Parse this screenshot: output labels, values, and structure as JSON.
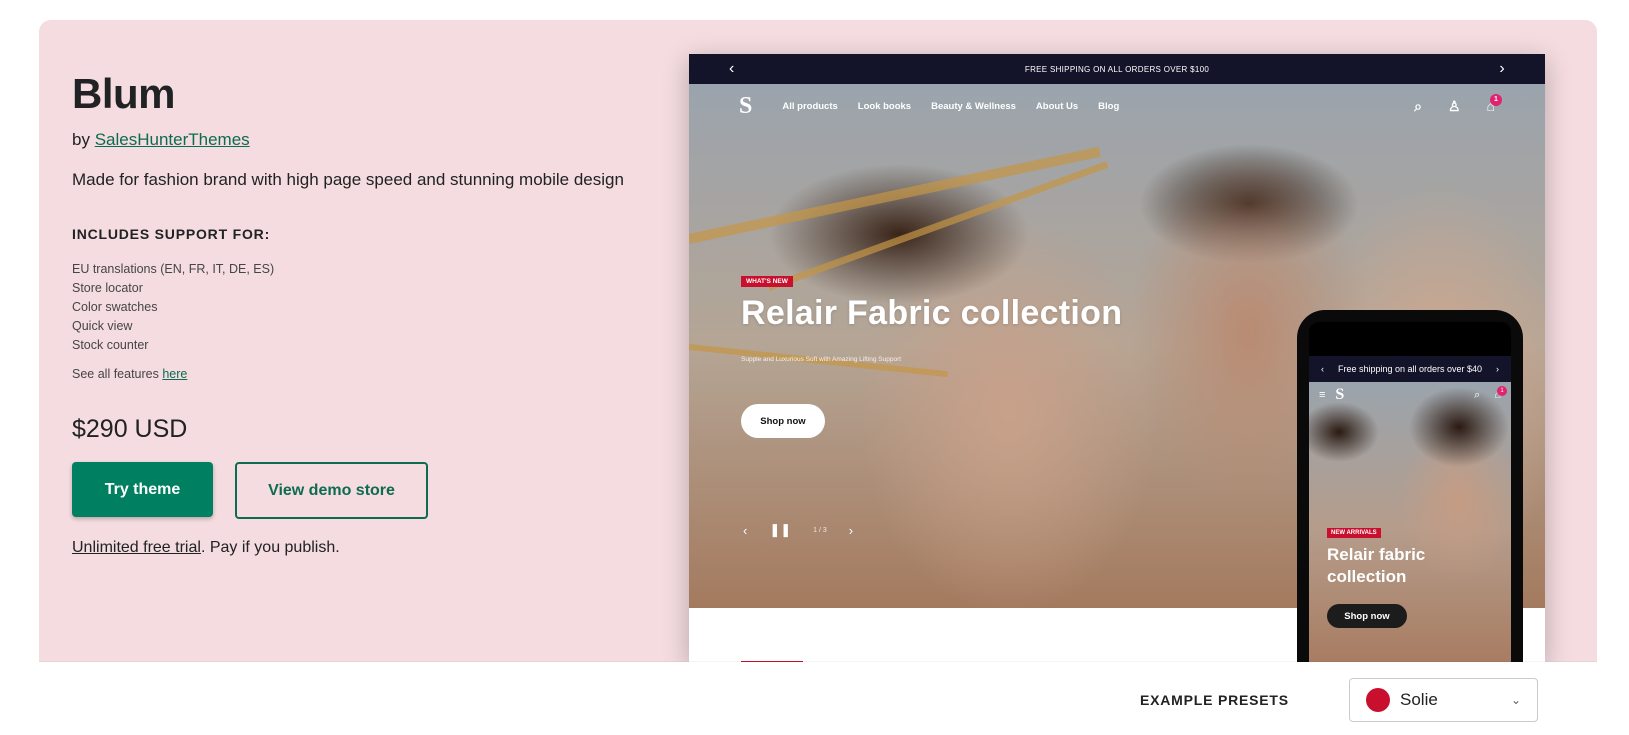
{
  "theme": {
    "name": "Blum",
    "by_prefix": "by ",
    "author": "SalesHunterThemes",
    "tagline": "Made for fashion brand with high page speed and stunning mobile design",
    "includes_title": "INCLUDES SUPPORT FOR:",
    "features": [
      "EU translations (EN, FR, IT, DE, ES)",
      "Store locator",
      "Color swatches",
      "Quick view",
      "Stock counter"
    ],
    "see_all_prefix": "See all features ",
    "see_all_link": "here",
    "price": "$290 USD",
    "try_label": "Try theme",
    "demo_label": "View demo store",
    "trial_link": "Unlimited free trial",
    "trial_suffix": ". Pay if you publish."
  },
  "desktop_preview": {
    "announcement": "FREE SHIPPING ON ALL ORDERS OVER $100",
    "logo": "S",
    "nav": [
      "All products",
      "Look books",
      "Beauty & Wellness",
      "About Us",
      "Blog"
    ],
    "cart_count": "1",
    "badge": "WHAT'S NEW",
    "headline": "Relair Fabric collection",
    "subline": "Supple and Luxurious Soft with Amazing Lifting Support",
    "shop_label": "Shop now",
    "slide_counter": "1 / 3"
  },
  "mobile_preview": {
    "announcement": "Free shipping on all orders over $40",
    "logo": "S",
    "cart_count": "1",
    "badge": "NEW ARRIVALS",
    "headline": "Relair fabric collection",
    "shop_label": "Shop now"
  },
  "presets": {
    "label": "EXAMPLE PRESETS",
    "selected": "Solie",
    "swatch_color": "#c8102e"
  },
  "colors": {
    "hero_bg": "#f4dce0",
    "primary": "#008060",
    "link": "#0d6b50",
    "accent_red": "#c8102e"
  }
}
